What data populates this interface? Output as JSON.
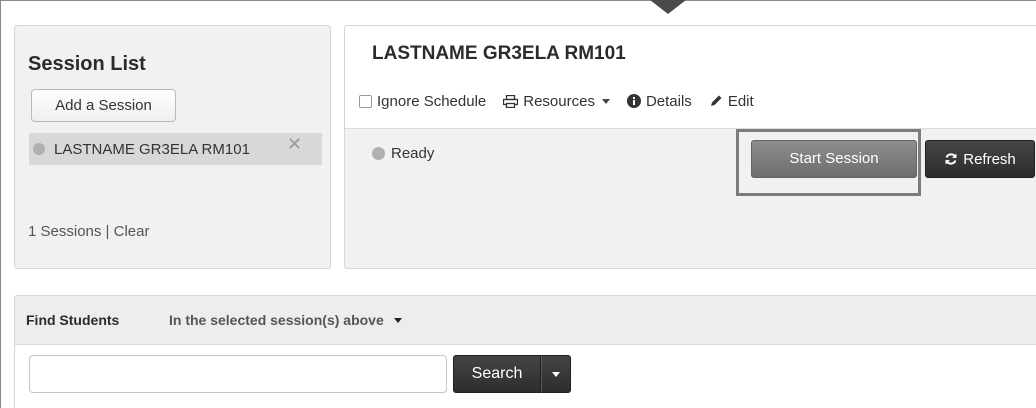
{
  "session_list": {
    "title": "Session List",
    "add_button_label": "Add a Session",
    "sessions": [
      {
        "name": "LASTNAME GR3ELA RM101",
        "remove_glyph": "✕"
      }
    ],
    "footer": {
      "count_label": "1 Sessions",
      "separator": " | ",
      "clear_label": "Clear"
    }
  },
  "session_detail": {
    "title": "LASTNAME GR3ELA RM101",
    "toolbar": {
      "ignore_schedule_label": "Ignore Schedule",
      "resources_label": "Resources",
      "details_label": "Details",
      "edit_label": "Edit"
    },
    "status_label": "Ready",
    "start_button_label": "Start Session",
    "refresh_button_label": "Refresh"
  },
  "find_students": {
    "label": "Find Students",
    "scope_label": "In the selected session(s) above",
    "search_value": "",
    "search_button_label": "Search"
  },
  "icons": {
    "resources": "printer-icon",
    "details": "info-icon",
    "edit": "pencil-icon",
    "refresh": "refresh-icon",
    "status": "status-dot-icon"
  },
  "colors": {
    "panel_bg": "#f1f1f1",
    "dark_button": "#333333",
    "start_button": "#7d7d7d",
    "highlight_border": "#7c7c7c"
  }
}
